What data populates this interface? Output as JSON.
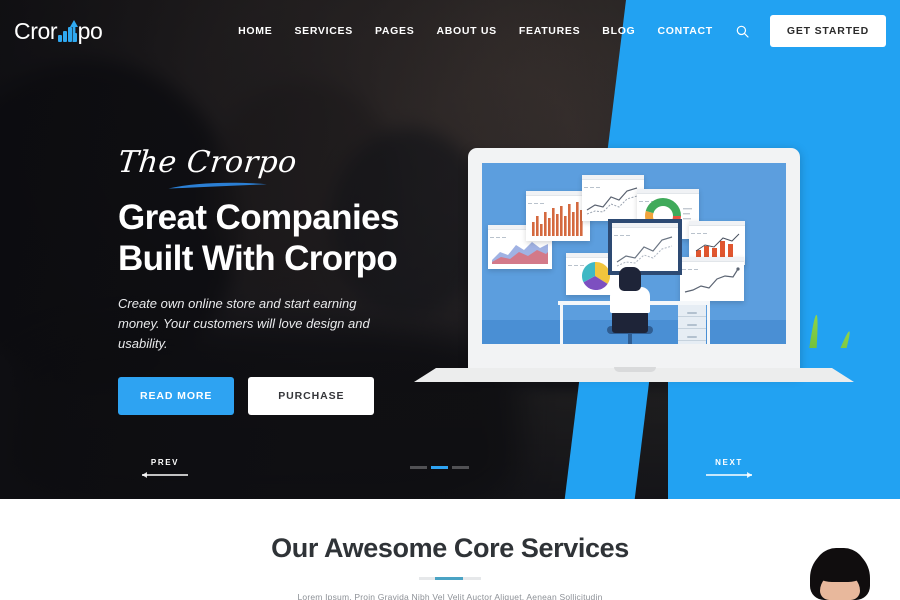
{
  "brand": {
    "name_left": "Cror",
    "name_right": "po",
    "logo_icon": "bar-chart-growth-icon",
    "accent_color": "#2ea3f2"
  },
  "header": {
    "nav_items": [
      {
        "label": "HOME"
      },
      {
        "label": "SERVICES"
      },
      {
        "label": "PAGES"
      },
      {
        "label": "ABOUT US"
      },
      {
        "label": "FEATURES"
      },
      {
        "label": "BLOG"
      },
      {
        "label": "CONTACT"
      }
    ],
    "search_icon": "search-icon",
    "cta_label": "GET STARTED"
  },
  "hero": {
    "eyebrow": "The Crorpo",
    "headline_line1": "Great Companies",
    "headline_line2": "Built With Crorpo",
    "subcopy": "Create own online store and start earning money. Your customers will love design and usability.",
    "primary_button": "READ MORE",
    "secondary_button": "PURCHASE",
    "prev_label": "PREV",
    "next_label": "NEXT",
    "slide_count": 3,
    "active_slide": 2,
    "background_color": "#141518",
    "panel_color": "#22a2f2"
  },
  "illustration": {
    "name": "laptop-analytics-dashboard",
    "screen_color": "#5c9ede",
    "cards": [
      {
        "name": "area-chart-card"
      },
      {
        "name": "bar-chart-card"
      },
      {
        "name": "line-chart-card"
      },
      {
        "name": "donut-chart-card"
      },
      {
        "name": "pie-chart-card"
      },
      {
        "name": "orange-bar-chart-card"
      },
      {
        "name": "growth-line-chart-card"
      },
      {
        "name": "monitor-line-chart"
      }
    ]
  },
  "services": {
    "title": "Our Awesome Core Services",
    "subtitle": "Lorem Ipsum. Proin Gravida Nibh Vel Velit Auctor Aliquet. Aenean Sollicitudin",
    "divider_color": "#4aa3c4"
  }
}
